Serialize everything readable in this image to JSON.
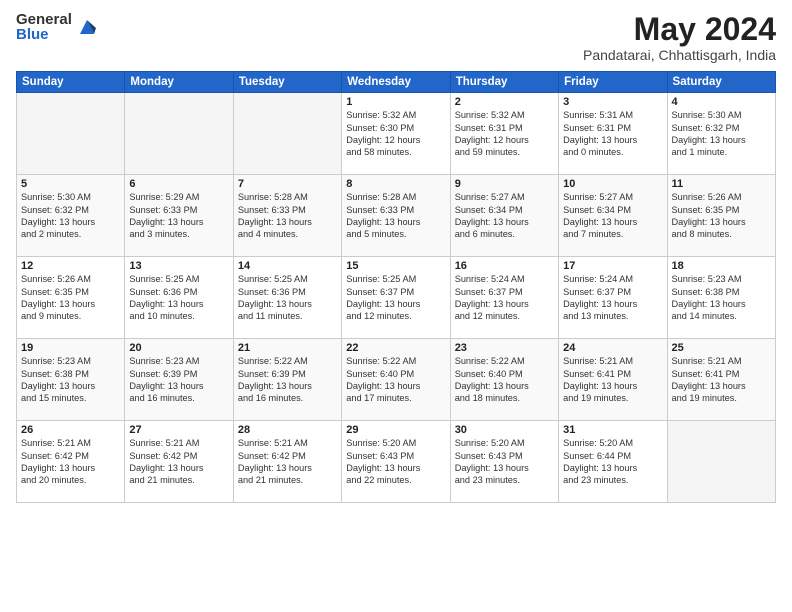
{
  "header": {
    "logo_general": "General",
    "logo_blue": "Blue",
    "title": "May 2024",
    "location": "Pandatarai, Chhattisgarh, India"
  },
  "weekdays": [
    "Sunday",
    "Monday",
    "Tuesday",
    "Wednesday",
    "Thursday",
    "Friday",
    "Saturday"
  ],
  "weeks": [
    [
      {
        "day": "",
        "info": ""
      },
      {
        "day": "",
        "info": ""
      },
      {
        "day": "",
        "info": ""
      },
      {
        "day": "1",
        "info": "Sunrise: 5:32 AM\nSunset: 6:30 PM\nDaylight: 12 hours\nand 58 minutes."
      },
      {
        "day": "2",
        "info": "Sunrise: 5:32 AM\nSunset: 6:31 PM\nDaylight: 12 hours\nand 59 minutes."
      },
      {
        "day": "3",
        "info": "Sunrise: 5:31 AM\nSunset: 6:31 PM\nDaylight: 13 hours\nand 0 minutes."
      },
      {
        "day": "4",
        "info": "Sunrise: 5:30 AM\nSunset: 6:32 PM\nDaylight: 13 hours\nand 1 minute."
      }
    ],
    [
      {
        "day": "5",
        "info": "Sunrise: 5:30 AM\nSunset: 6:32 PM\nDaylight: 13 hours\nand 2 minutes."
      },
      {
        "day": "6",
        "info": "Sunrise: 5:29 AM\nSunset: 6:33 PM\nDaylight: 13 hours\nand 3 minutes."
      },
      {
        "day": "7",
        "info": "Sunrise: 5:28 AM\nSunset: 6:33 PM\nDaylight: 13 hours\nand 4 minutes."
      },
      {
        "day": "8",
        "info": "Sunrise: 5:28 AM\nSunset: 6:33 PM\nDaylight: 13 hours\nand 5 minutes."
      },
      {
        "day": "9",
        "info": "Sunrise: 5:27 AM\nSunset: 6:34 PM\nDaylight: 13 hours\nand 6 minutes."
      },
      {
        "day": "10",
        "info": "Sunrise: 5:27 AM\nSunset: 6:34 PM\nDaylight: 13 hours\nand 7 minutes."
      },
      {
        "day": "11",
        "info": "Sunrise: 5:26 AM\nSunset: 6:35 PM\nDaylight: 13 hours\nand 8 minutes."
      }
    ],
    [
      {
        "day": "12",
        "info": "Sunrise: 5:26 AM\nSunset: 6:35 PM\nDaylight: 13 hours\nand 9 minutes."
      },
      {
        "day": "13",
        "info": "Sunrise: 5:25 AM\nSunset: 6:36 PM\nDaylight: 13 hours\nand 10 minutes."
      },
      {
        "day": "14",
        "info": "Sunrise: 5:25 AM\nSunset: 6:36 PM\nDaylight: 13 hours\nand 11 minutes."
      },
      {
        "day": "15",
        "info": "Sunrise: 5:25 AM\nSunset: 6:37 PM\nDaylight: 13 hours\nand 12 minutes."
      },
      {
        "day": "16",
        "info": "Sunrise: 5:24 AM\nSunset: 6:37 PM\nDaylight: 13 hours\nand 12 minutes."
      },
      {
        "day": "17",
        "info": "Sunrise: 5:24 AM\nSunset: 6:37 PM\nDaylight: 13 hours\nand 13 minutes."
      },
      {
        "day": "18",
        "info": "Sunrise: 5:23 AM\nSunset: 6:38 PM\nDaylight: 13 hours\nand 14 minutes."
      }
    ],
    [
      {
        "day": "19",
        "info": "Sunrise: 5:23 AM\nSunset: 6:38 PM\nDaylight: 13 hours\nand 15 minutes."
      },
      {
        "day": "20",
        "info": "Sunrise: 5:23 AM\nSunset: 6:39 PM\nDaylight: 13 hours\nand 16 minutes."
      },
      {
        "day": "21",
        "info": "Sunrise: 5:22 AM\nSunset: 6:39 PM\nDaylight: 13 hours\nand 16 minutes."
      },
      {
        "day": "22",
        "info": "Sunrise: 5:22 AM\nSunset: 6:40 PM\nDaylight: 13 hours\nand 17 minutes."
      },
      {
        "day": "23",
        "info": "Sunrise: 5:22 AM\nSunset: 6:40 PM\nDaylight: 13 hours\nand 18 minutes."
      },
      {
        "day": "24",
        "info": "Sunrise: 5:21 AM\nSunset: 6:41 PM\nDaylight: 13 hours\nand 19 minutes."
      },
      {
        "day": "25",
        "info": "Sunrise: 5:21 AM\nSunset: 6:41 PM\nDaylight: 13 hours\nand 19 minutes."
      }
    ],
    [
      {
        "day": "26",
        "info": "Sunrise: 5:21 AM\nSunset: 6:42 PM\nDaylight: 13 hours\nand 20 minutes."
      },
      {
        "day": "27",
        "info": "Sunrise: 5:21 AM\nSunset: 6:42 PM\nDaylight: 13 hours\nand 21 minutes."
      },
      {
        "day": "28",
        "info": "Sunrise: 5:21 AM\nSunset: 6:42 PM\nDaylight: 13 hours\nand 21 minutes."
      },
      {
        "day": "29",
        "info": "Sunrise: 5:20 AM\nSunset: 6:43 PM\nDaylight: 13 hours\nand 22 minutes."
      },
      {
        "day": "30",
        "info": "Sunrise: 5:20 AM\nSunset: 6:43 PM\nDaylight: 13 hours\nand 23 minutes."
      },
      {
        "day": "31",
        "info": "Sunrise: 5:20 AM\nSunset: 6:44 PM\nDaylight: 13 hours\nand 23 minutes."
      },
      {
        "day": "",
        "info": ""
      }
    ]
  ]
}
